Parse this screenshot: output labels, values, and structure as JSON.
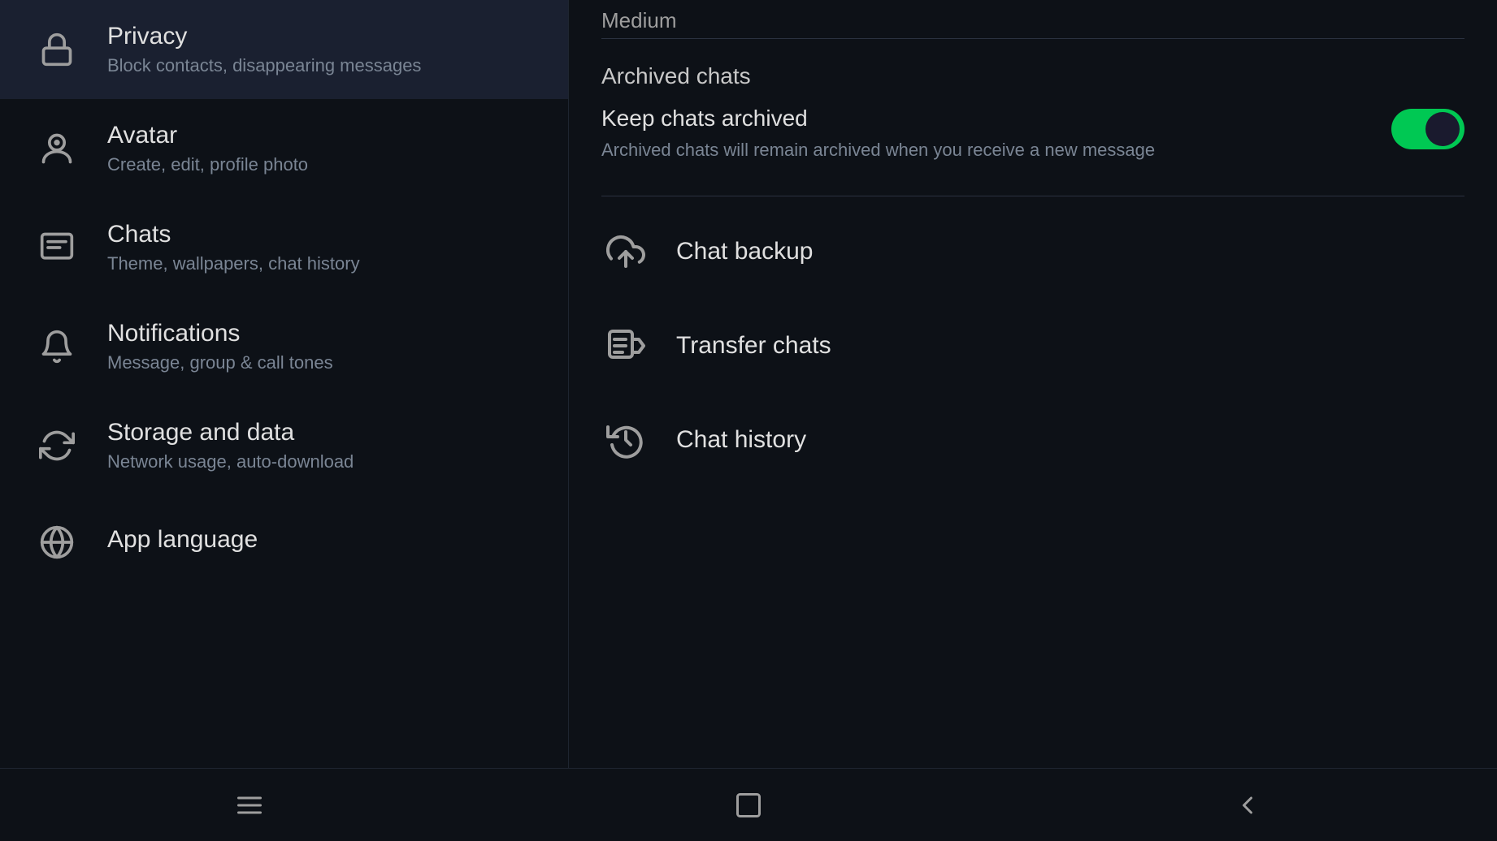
{
  "header": {
    "top_label": "Medium"
  },
  "left_panel": {
    "items": [
      {
        "name": "privacy",
        "title": "Privacy",
        "subtitle": "Block contacts, disappearing messages",
        "icon": "lock"
      },
      {
        "name": "avatar",
        "title": "Avatar",
        "subtitle": "Create, edit, profile photo",
        "icon": "avatar"
      },
      {
        "name": "chats",
        "title": "Chats",
        "subtitle": "Theme, wallpapers, chat history",
        "icon": "chat"
      },
      {
        "name": "notifications",
        "title": "Notifications",
        "subtitle": "Message, group & call tones",
        "icon": "bell"
      },
      {
        "name": "storage",
        "title": "Storage and data",
        "subtitle": "Network usage, auto-download",
        "icon": "storage"
      },
      {
        "name": "app_language",
        "title": "App language",
        "subtitle": "",
        "icon": "globe"
      }
    ]
  },
  "right_panel": {
    "archived_section_label": "Archived chats",
    "keep_archived_title": "Keep chats archived",
    "keep_archived_subtitle": "Archived chats will remain archived when you receive a new message",
    "toggle_on": true,
    "chat_options": [
      {
        "name": "chat_backup",
        "label": "Chat backup",
        "icon": "cloud-upload"
      },
      {
        "name": "transfer_chats",
        "label": "Transfer chats",
        "icon": "transfer"
      },
      {
        "name": "chat_history",
        "label": "Chat history",
        "icon": "history"
      }
    ]
  },
  "bottom_nav": {
    "buttons": [
      {
        "name": "menu",
        "icon": "menu"
      },
      {
        "name": "home",
        "icon": "square"
      },
      {
        "name": "back",
        "icon": "chevron-left"
      }
    ]
  },
  "colors": {
    "background": "#0d1117",
    "text_primary": "#e0e0e0",
    "text_secondary": "#7a8594",
    "accent": "#00a884",
    "toggle_on": "#00c853",
    "divider": "#2a3140",
    "icon": "#9e9e9e"
  }
}
